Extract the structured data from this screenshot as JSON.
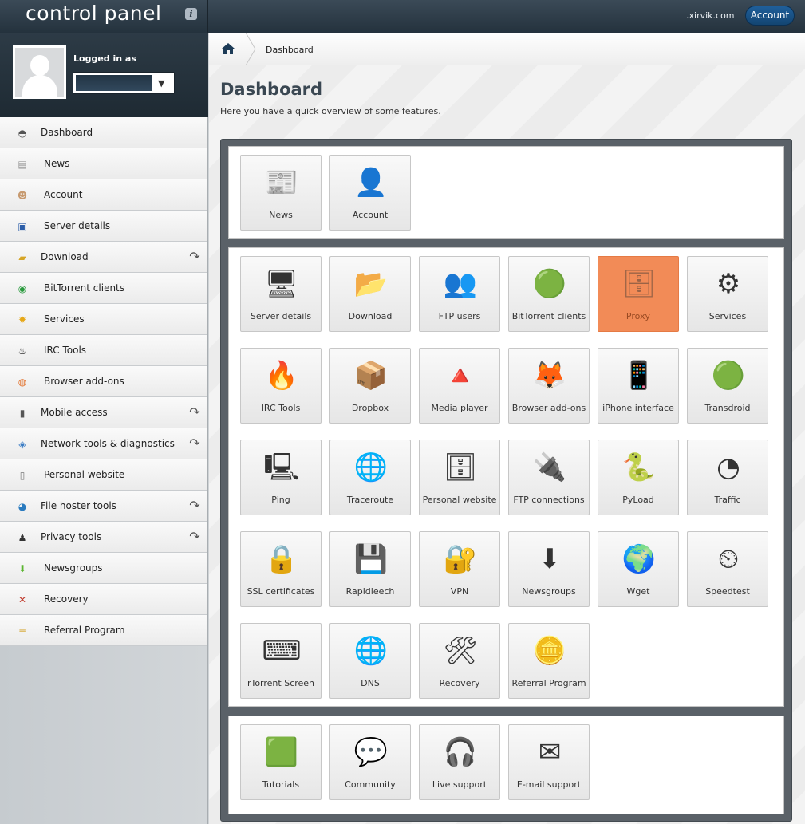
{
  "header": {
    "logo_text": "control panel",
    "info_label": "i",
    "domain": ".xirvik.com",
    "account_button": "Account"
  },
  "user": {
    "logged_in_label": "Logged in as",
    "dropdown_arrow": "▼"
  },
  "sidebar": {
    "items": [
      {
        "label": "Dashboard",
        "icon": "gauge-icon",
        "glyph": "◓",
        "color": "#555",
        "submenu": false
      },
      {
        "label": "News",
        "icon": "newspaper-icon",
        "glyph": "▤",
        "color": "#999",
        "submenu": false
      },
      {
        "label": "Account",
        "icon": "user-icon",
        "glyph": "☻",
        "color": "#c79a70",
        "submenu": false
      },
      {
        "label": "Server details",
        "icon": "monitor-icon",
        "glyph": "▣",
        "color": "#2b5da8",
        "submenu": false
      },
      {
        "label": "Download",
        "icon": "folder-icon",
        "glyph": "▰",
        "color": "#d6a526",
        "submenu": true
      },
      {
        "label": "BitTorrent clients",
        "icon": "bittorrent-icon",
        "glyph": "◉",
        "color": "#2a9b3e",
        "submenu": false
      },
      {
        "label": "Services",
        "icon": "gear-icon",
        "glyph": "✹",
        "color": "#e6a818",
        "submenu": false
      },
      {
        "label": "IRC Tools",
        "icon": "flame-icon",
        "glyph": "♨",
        "color": "#111",
        "submenu": false
      },
      {
        "label": "Browser add-ons",
        "icon": "firefox-icon",
        "glyph": "◍",
        "color": "#e2702a",
        "submenu": false
      },
      {
        "label": "Mobile access",
        "icon": "phone-icon",
        "glyph": "▮",
        "color": "#555",
        "submenu": true
      },
      {
        "label": "Network tools & diagnostics",
        "icon": "network-icon",
        "glyph": "◈",
        "color": "#3a7cc4",
        "submenu": true
      },
      {
        "label": "Personal website",
        "icon": "server-icon",
        "glyph": "▯",
        "color": "#777",
        "submenu": false
      },
      {
        "label": "File hoster tools",
        "icon": "globe-icon",
        "glyph": "◕",
        "color": "#2a7bbf",
        "submenu": true
      },
      {
        "label": "Privacy tools",
        "icon": "spy-icon",
        "glyph": "♟",
        "color": "#333",
        "submenu": true
      },
      {
        "label": "Newsgroups",
        "icon": "arrow-down-icon",
        "glyph": "⬇",
        "color": "#5ab52f",
        "submenu": false
      },
      {
        "label": "Recovery",
        "icon": "tools-icon",
        "glyph": "✕",
        "color": "#c0392b",
        "submenu": false
      },
      {
        "label": "Referral Program",
        "icon": "coins-icon",
        "glyph": "≡",
        "color": "#d2a021",
        "submenu": false
      }
    ],
    "submenu_glyph": "↷"
  },
  "breadcrumb": {
    "current": "Dashboard"
  },
  "main": {
    "title": "Dashboard",
    "subtitle": "Here you have a quick overview of some features."
  },
  "panels": [
    {
      "tiles": [
        {
          "label": "News",
          "icon": "newspaper-icon",
          "glyph": "📰",
          "active": false
        },
        {
          "label": "Account",
          "icon": "user-icon",
          "glyph": "👤",
          "active": false
        }
      ]
    },
    {
      "tiles": [
        {
          "label": "Server details",
          "icon": "monitor-icon",
          "glyph": "🖥",
          "active": false
        },
        {
          "label": "Download",
          "icon": "folder-icon",
          "glyph": "📂",
          "active": false
        },
        {
          "label": "FTP users",
          "icon": "users-icon",
          "glyph": "👥",
          "active": false
        },
        {
          "label": "BitTorrent clients",
          "icon": "bittorrent-icon",
          "glyph": "🟢",
          "active": false
        },
        {
          "label": "Proxy",
          "icon": "proxy-server-icon",
          "glyph": "🗄",
          "active": true
        },
        {
          "label": "Services",
          "icon": "gear-info-icon",
          "glyph": "⚙",
          "active": false
        },
        {
          "label": "IRC Tools",
          "icon": "flame-icon",
          "glyph": "🔥",
          "active": false
        },
        {
          "label": "Dropbox",
          "icon": "dropbox-icon",
          "glyph": "📦",
          "active": false
        },
        {
          "label": "Media player",
          "icon": "traffic-cone-icon",
          "glyph": "🔺",
          "active": false
        },
        {
          "label": "Browser add-ons",
          "icon": "firefox-icon",
          "glyph": "🦊",
          "active": false
        },
        {
          "label": "iPhone interface",
          "icon": "iphone-icon",
          "glyph": "📱",
          "active": false
        },
        {
          "label": "Transdroid",
          "icon": "transdroid-icon",
          "glyph": "🟢",
          "active": false
        },
        {
          "label": "Ping",
          "icon": "network-computer-icon",
          "glyph": "🖳",
          "active": false
        },
        {
          "label": "Traceroute",
          "icon": "globe-icon",
          "glyph": "🌐",
          "active": false
        },
        {
          "label": "Personal website",
          "icon": "server-globe-icon",
          "glyph": "🗄",
          "active": false
        },
        {
          "label": "FTP connections",
          "icon": "cable-icon",
          "glyph": "🔌",
          "active": false
        },
        {
          "label": "PyLoad",
          "icon": "python-icon",
          "glyph": "🐍",
          "active": false
        },
        {
          "label": "Traffic",
          "icon": "pie-chart-icon",
          "glyph": "◔",
          "active": false
        },
        {
          "label": "SSL certificates",
          "icon": "ssl-lock-icon",
          "glyph": "🔒",
          "active": false
        },
        {
          "label": "Rapidleech",
          "icon": "hdd-download-icon",
          "glyph": "💾",
          "active": false
        },
        {
          "label": "VPN",
          "icon": "globe-lock-icon",
          "glyph": "🔐",
          "active": false
        },
        {
          "label": "Newsgroups",
          "icon": "arrow-down-icon",
          "glyph": "⬇",
          "active": false
        },
        {
          "label": "Wget",
          "icon": "wget-globe-icon",
          "glyph": "🌍",
          "active": false
        },
        {
          "label": "Speedtest",
          "icon": "speedometer-icon",
          "glyph": "⏲",
          "active": false
        },
        {
          "label": "rTorrent Screen",
          "icon": "terminal-icon",
          "glyph": "⌨",
          "active": false
        },
        {
          "label": "DNS",
          "icon": "dns-globe-icon",
          "glyph": "🌐",
          "active": false
        },
        {
          "label": "Recovery",
          "icon": "tools-icon",
          "glyph": "🛠",
          "active": false
        },
        {
          "label": "Referral Program",
          "icon": "coins-icon",
          "glyph": "🪙",
          "active": false
        }
      ]
    },
    {
      "tiles": [
        {
          "label": "Tutorials",
          "icon": "chalkboard-icon",
          "glyph": "🟩",
          "active": false
        },
        {
          "label": "Community",
          "icon": "chat-bubble-icon",
          "glyph": "💬",
          "active": false
        },
        {
          "label": "Live support",
          "icon": "headset-icon",
          "glyph": "🎧",
          "active": false
        },
        {
          "label": "E-mail support",
          "icon": "envelope-icon",
          "glyph": "✉",
          "active": false
        }
      ]
    }
  ],
  "colors": {
    "accent": "#1f5f9a",
    "active_tile": "#f28b57",
    "header_bg": "#2b3944",
    "panel_frame": "#5a6168"
  }
}
